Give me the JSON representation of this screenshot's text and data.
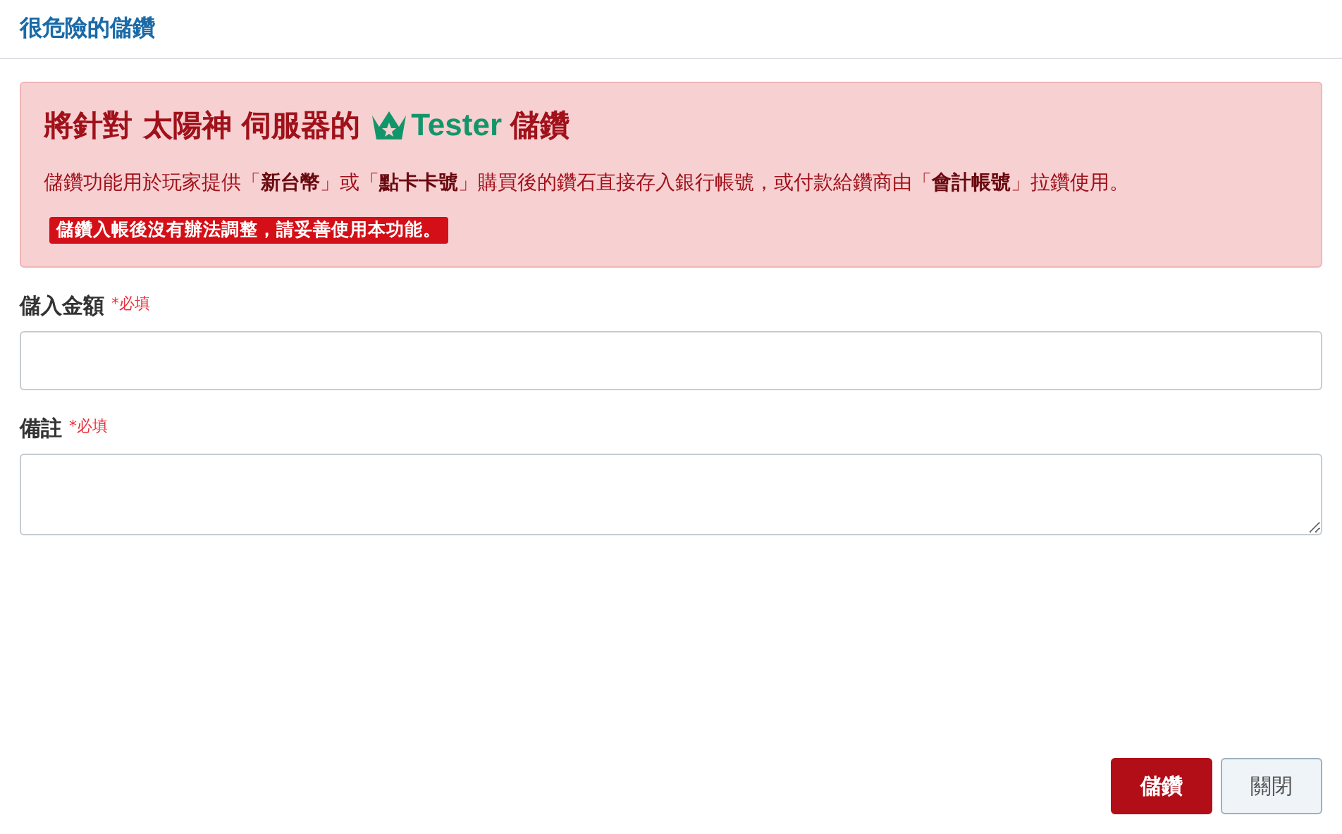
{
  "window": {
    "title": "很危險的儲鑽"
  },
  "alert": {
    "heading_before": "將針對 太陽神 伺服器的",
    "brand": "Tester",
    "heading_after": "儲鑽",
    "message": "儲鑽功能用於玩家提供「**新台幣**」或「**點卡卡號**」購買後的鑽石直接存入銀行帳號，或付款給鑽商由「**會計帳號**」拉鑽使用。",
    "warning": "儲鑽入帳後沒有辦法調整，請妥善使用本功能。"
  },
  "fields": [
    {
      "label": "儲入金額",
      "required": "*必填",
      "kind": "input"
    },
    {
      "label": "備註",
      "required": "*必填",
      "kind": "textarea"
    }
  ],
  "buttons": [
    {
      "label": "儲鑽",
      "kind": "primary"
    },
    {
      "label": "關閉",
      "kind": "secondary"
    }
  ]
}
